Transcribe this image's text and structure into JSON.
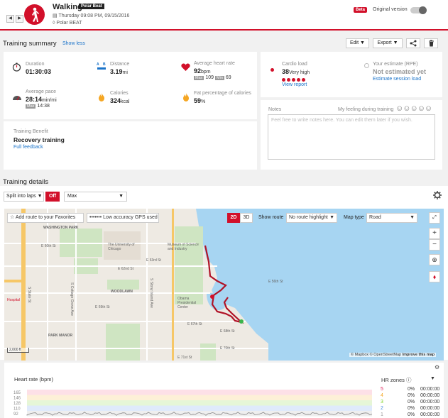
{
  "header": {
    "title": "Walking",
    "product_badge": "Polar Beat",
    "datetime": "Thursday 09:08 PM, 09/15/2016",
    "device": "Polar BEAT",
    "beta_label": "Beta",
    "original_version_label": "Original version",
    "nav_prev_icon": "◀",
    "nav_next_icon": "▶"
  },
  "summary": {
    "title": "Training summary",
    "show_less": "Show less",
    "edit_label": "Edit",
    "export_label": "Export",
    "duration": {
      "label": "Duration",
      "value": "01:30:03"
    },
    "distance": {
      "label": "Distance",
      "value": "3.19",
      "unit": "mi"
    },
    "avg_hr": {
      "label": "Average heart rate",
      "value": "92",
      "unit": "bpm",
      "max_label": "Max",
      "max": "109",
      "min_label": "Min",
      "min": "69"
    },
    "avg_pace": {
      "label": "Average pace",
      "value": "28:14",
      "unit": "min/mi",
      "max_label": "Max",
      "max": "14:38"
    },
    "calories": {
      "label": "Calories",
      "value": "324",
      "unit": "kcal"
    },
    "fat": {
      "label": "Fat percentage of calories",
      "value": "59",
      "unit": "%"
    },
    "benefit": {
      "label": "Training Benefit",
      "value": "Recovery training",
      "link": "Full feedback"
    },
    "cardio": {
      "label": "Cardio load",
      "value": "38",
      "desc": "Very high",
      "link": "View report",
      "level": 5
    },
    "rpe": {
      "label": "Your estimate (RPE)",
      "value": "Not estimated yet",
      "link": "Estimate session load"
    },
    "notes": {
      "label": "Notes",
      "feeling_label": "My feeling during training",
      "faces": "☺☺☺☺☺",
      "placeholder": "Feel free to write notes here. You can edit them later if you wish."
    }
  },
  "details": {
    "title": "Training details",
    "split_label": "Split into laps",
    "split_toggle": "Off",
    "metric_select": "Max"
  },
  "map": {
    "add_route": "Add route to your Favorites",
    "gps_label": "Low accuracy GPS used",
    "btn_2d": "2D",
    "btn_3d": "3D",
    "show_route_label": "Show route",
    "route_select": "No route highlight",
    "map_type_label": "Map type",
    "map_type_select": "Road",
    "attribution": "© Mapbox © OpenStreetMap",
    "improve": "Improve this map",
    "scale": "2,000 ft",
    "labels": {
      "washington_park": "WASHINGTON PARK",
      "uchicago": "The University of Chicago",
      "museum": "Museum of Science and Industry",
      "woodlawn": "WOODLAWN",
      "obama": "Obama Presidential Center",
      "park_manor": "PARK MANOR",
      "hospital": "Hospital",
      "e60": "E 60th St",
      "e62": "E 62nd St",
      "e63": "E 63rd St",
      "e67": "E 67th St",
      "e68": "E 68th St",
      "e69": "E 69th St",
      "e70": "E 70th St",
      "e71": "E 71st St",
      "e56": "E 56th St",
      "s_state": "S State St",
      "s_stony": "S Stony Island Ave",
      "s_cottage": "S Cottage Grove Ave"
    }
  },
  "hr": {
    "title": "Heart rate (bpm)",
    "zones_title": "HR zones",
    "yticks": [
      "165",
      "146",
      "128",
      "110",
      "92"
    ],
    "zones": [
      {
        "n": "5",
        "pct": "0%",
        "time": "00:00:00",
        "color": "#e0245e"
      },
      {
        "n": "4",
        "pct": "0%",
        "time": "00:00:00",
        "color": "#f5a623"
      },
      {
        "n": "3",
        "pct": "0%",
        "time": "00:00:00",
        "color": "#7ed321"
      },
      {
        "n": "2",
        "pct": "0%",
        "time": "00:00:00",
        "color": "#4a90e2"
      },
      {
        "n": "1",
        "pct": "0%",
        "time": "00:00:00",
        "color": "#9b9b9b"
      }
    ]
  },
  "colors": {
    "accent": "#d2102a",
    "link": "#1a73c9",
    "water": "#a7d5f2",
    "park": "#cfe5c2"
  }
}
